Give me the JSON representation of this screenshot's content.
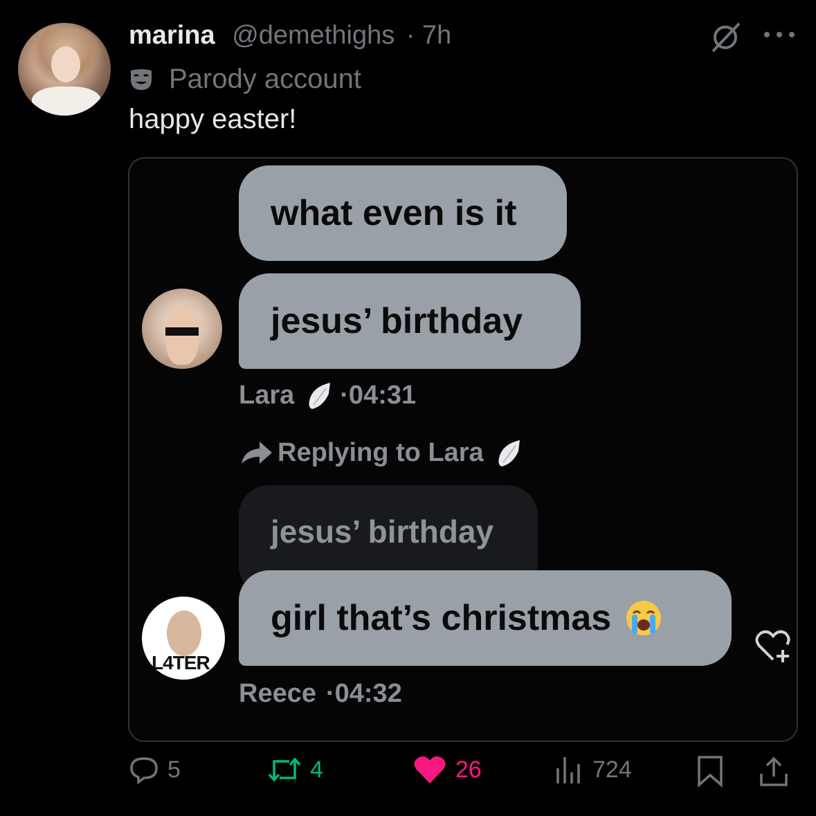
{
  "tweet": {
    "display_name": "marina",
    "handle": "@demethighs",
    "time": "· 7h",
    "label": "Parody account",
    "text": "happy easter!"
  },
  "chat": {
    "bubble1": "what even is it",
    "bubble2": "jesus’ birthday",
    "sender1": "Lara",
    "time1": "·04:31",
    "reply_prefix": "Replying to Lara",
    "quoted": "jesus’ birthday",
    "bubble3": "girl that’s christmas",
    "sender2": "Reece",
    "time2": "·04:32",
    "avatar2_text": "L4TER"
  },
  "actions": {
    "replies": "5",
    "reposts": "4",
    "likes": "26",
    "views": "724"
  },
  "colors": {
    "background": "#000000",
    "muted": "#71767b",
    "repost_green": "#00ba7c",
    "like_pink": "#f91880",
    "bubble_gray": "#9aa0a8"
  },
  "icons": [
    "mask-icon",
    "grok-icon",
    "more-icon",
    "wing-icon",
    "reply-arrow-icon",
    "crying-emoji-icon",
    "heart-add-icon",
    "reply-icon",
    "repost-icon",
    "like-icon",
    "views-icon",
    "bookmark-icon",
    "share-icon"
  ]
}
